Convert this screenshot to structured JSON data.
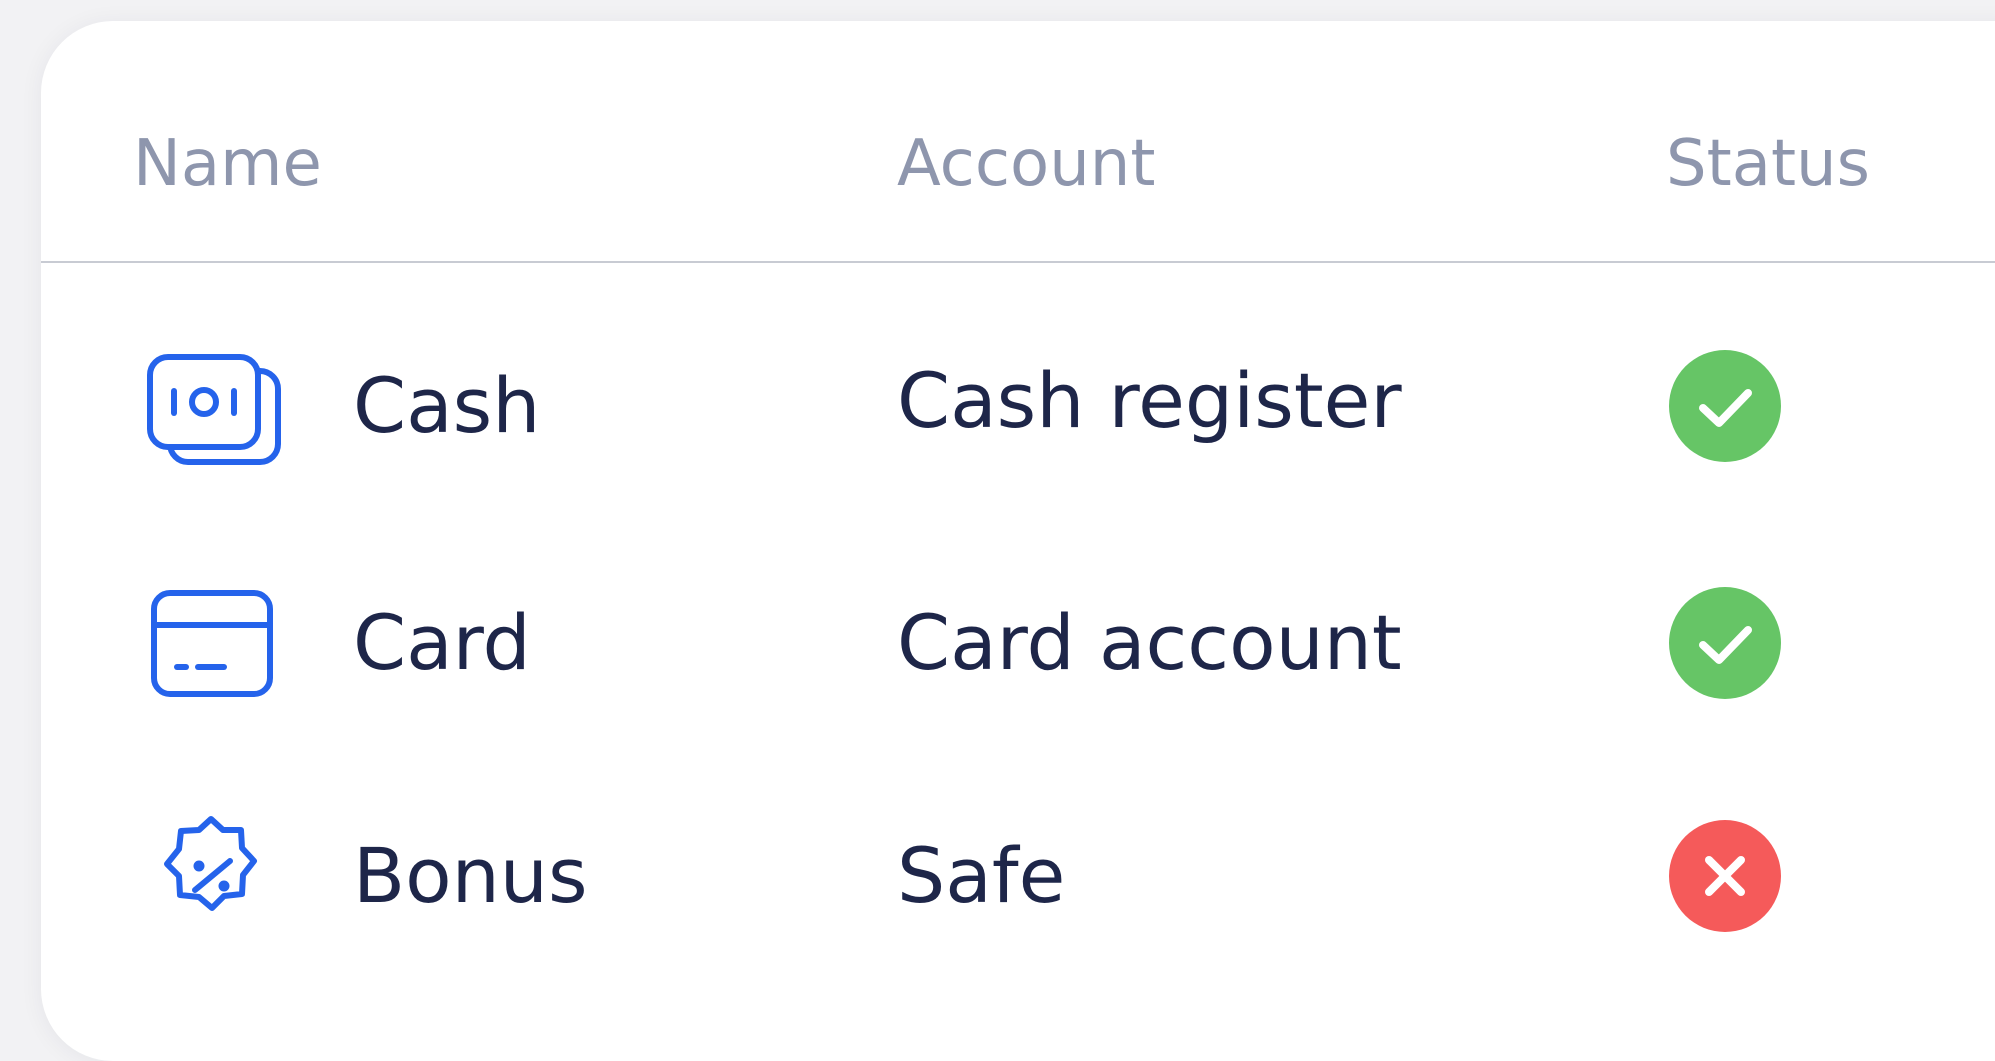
{
  "table": {
    "columns": {
      "name": "Name",
      "account": "Account",
      "status": "Status"
    },
    "rows": [
      {
        "icon": "cash-icon",
        "name": "Cash",
        "account": "Cash register",
        "status": "active",
        "status_icon": "check-icon",
        "status_color": "#66c566"
      },
      {
        "icon": "card-icon",
        "name": "Card",
        "account": "Card account",
        "status": "active",
        "status_icon": "check-icon",
        "status_color": "#66c566"
      },
      {
        "icon": "discount-badge-icon",
        "name": "Bonus",
        "account": "Safe",
        "status": "inactive",
        "status_icon": "close-icon",
        "status_color": "#f55a5a"
      }
    ]
  },
  "colors": {
    "icon_blue": "#2563eb",
    "text": "#1e2649",
    "header_text": "#8e96ad"
  }
}
